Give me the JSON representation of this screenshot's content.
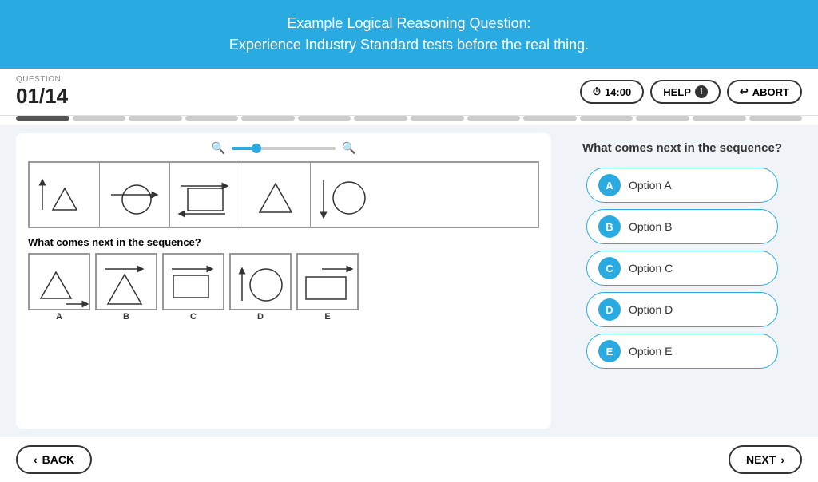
{
  "header": {
    "line1": "Example Logical Reasoning Question:",
    "line2": "Experience Industry Standard tests before the real thing."
  },
  "question_label": "QUESTION",
  "question_number": "01/14",
  "timer": {
    "label": "14:00"
  },
  "help_label": "HELP",
  "abort_label": "ABORT",
  "progress": {
    "total": 14,
    "done": 1
  },
  "sequence_question": "What comes next in the sequence?",
  "answer_label": "What comes next in the sequence?",
  "options": [
    {
      "id": "A",
      "label": "Option A"
    },
    {
      "id": "B",
      "label": "Option B"
    },
    {
      "id": "C",
      "label": "Option C"
    },
    {
      "id": "D",
      "label": "Option D"
    },
    {
      "id": "E",
      "label": "Option E"
    }
  ],
  "back_label": "BACK",
  "next_label": "NEXT"
}
